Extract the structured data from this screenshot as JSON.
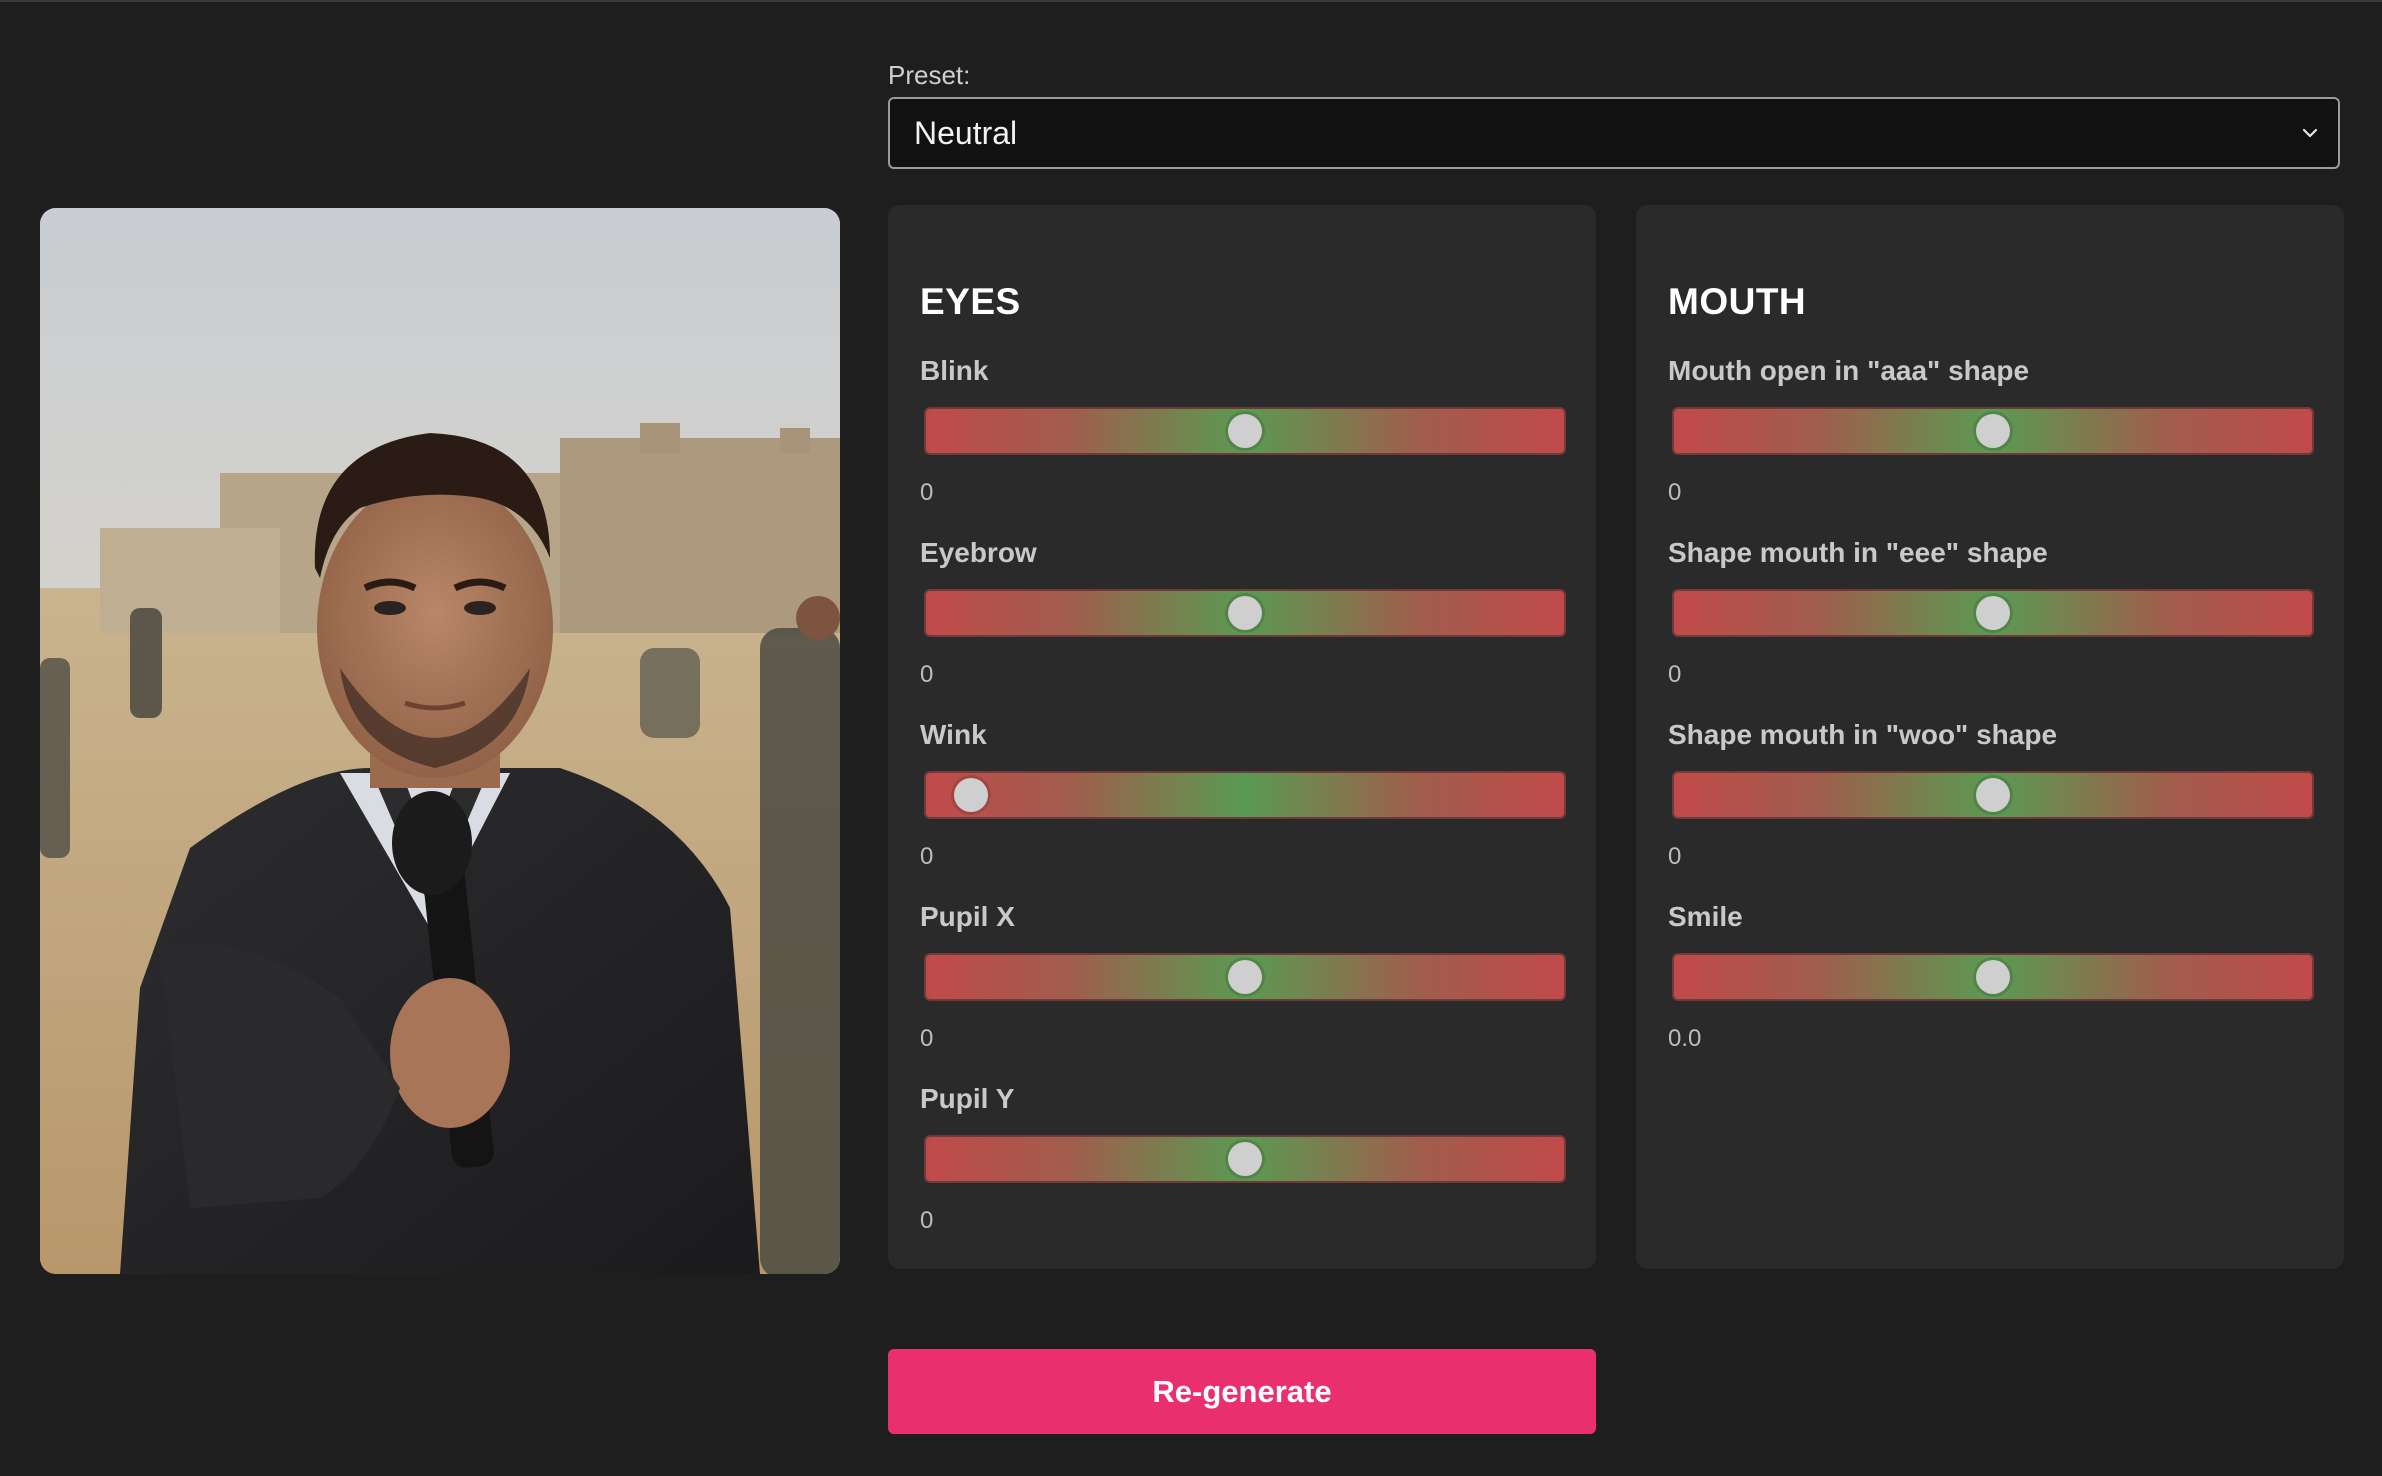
{
  "preset": {
    "label": "Preset:",
    "selected": "Neutral"
  },
  "photo": {
    "subject": "man in dark coat holding microphone in desert"
  },
  "eyes": {
    "title": "EYES",
    "sliders": [
      {
        "label": "Blink",
        "value": "0",
        "position": 0.5
      },
      {
        "label": "Eyebrow",
        "value": "0",
        "position": 0.5
      },
      {
        "label": "Wink",
        "value": "0",
        "position": 0.07
      },
      {
        "label": "Pupil X",
        "value": "0",
        "position": 0.5
      },
      {
        "label": "Pupil Y",
        "value": "0",
        "position": 0.5
      }
    ]
  },
  "mouth": {
    "title": "MOUTH",
    "sliders": [
      {
        "label": "Mouth open in \"aaa\" shape",
        "value": "0",
        "position": 0.5
      },
      {
        "label": "Shape mouth in \"eee\" shape",
        "value": "0",
        "position": 0.5
      },
      {
        "label": "Shape mouth in \"woo\" shape",
        "value": "0",
        "position": 0.5
      },
      {
        "label": "Smile",
        "value": "0.0",
        "position": 0.5
      }
    ]
  },
  "actions": {
    "regenerate_label": "Re-generate"
  },
  "colors": {
    "background": "#1e1e1e",
    "panel": "#2a2a2a",
    "accent": "#ea2f6e",
    "slider_red": "#c14a4a",
    "slider_green": "#5a9a52",
    "thumb": "#cfcfcf"
  },
  "icons": {
    "preset_chevron": "chevron-down-icon"
  }
}
